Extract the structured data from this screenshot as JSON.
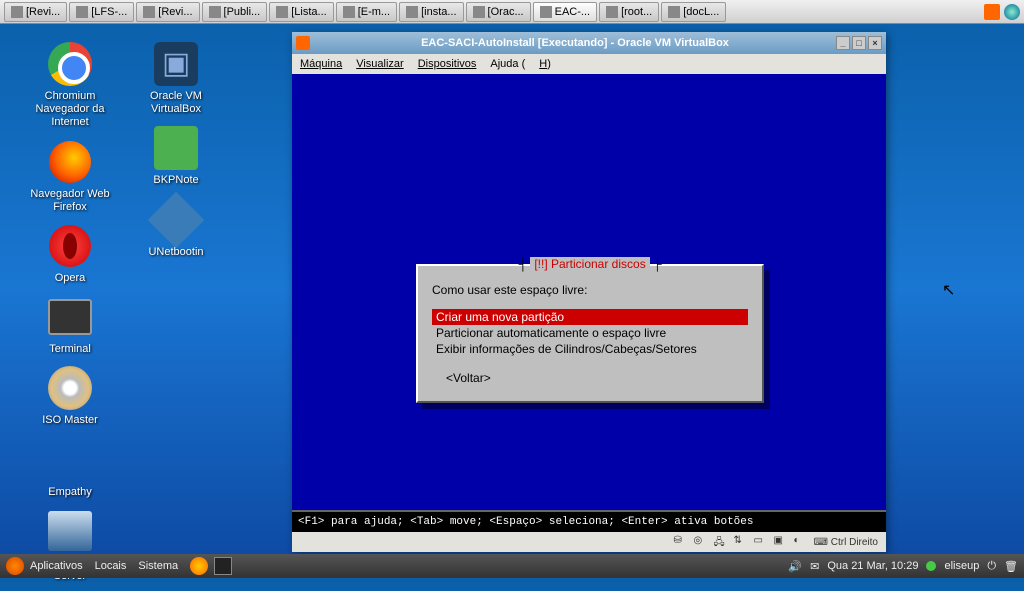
{
  "taskbar": {
    "items": [
      {
        "label": "[Revi..."
      },
      {
        "label": "[LFS-..."
      },
      {
        "label": "[Revi..."
      },
      {
        "label": "[Publi..."
      },
      {
        "label": "[Lista..."
      },
      {
        "label": "[E-m..."
      },
      {
        "label": "[insta..."
      },
      {
        "label": "[Orac..."
      },
      {
        "label": "EAC-..."
      },
      {
        "label": "[root..."
      },
      {
        "label": "[docL..."
      }
    ],
    "active_index": 8
  },
  "desktop": {
    "icons": [
      {
        "name": "chromium",
        "label": "Chromium Navegador da Internet",
        "shape": "ic-chrome"
      },
      {
        "name": "virtualbox",
        "label": "Oracle VM VirtualBox",
        "shape": "ic-vbox"
      },
      {
        "name": "firefox",
        "label": "Navegador Web Firefox",
        "shape": "ic-ff"
      },
      {
        "name": "bkpnote",
        "label": "BKPNote",
        "shape": "ic-bkp"
      },
      {
        "name": "opera",
        "label": "Opera",
        "shape": "ic-opera"
      },
      {
        "name": "unetbootin",
        "label": "UNetbootin",
        "shape": "ic-unet"
      },
      {
        "name": "terminal",
        "label": "Terminal",
        "shape": "ic-term"
      },
      {
        "name": "isomaster",
        "label": "ISO Master",
        "shape": "ic-iso"
      },
      {
        "name": "empathy",
        "label": "Empathy",
        "shape": "ic-emp"
      },
      {
        "name": "cts",
        "label": "Cliente do Terminal Server",
        "shape": "ic-cts"
      }
    ]
  },
  "vbox": {
    "title": "EAC-SACI-AutoInstall [Executando] - Oracle VM VirtualBox",
    "menu": {
      "m1": "Máquina",
      "m2": "Visualizar",
      "m3": "Dispositivos",
      "m4_pre": "Ajuda (",
      "m4_u": "H",
      "m4_post": ")"
    },
    "helpbar": "<F1> para ajuda; <Tab> move; <Espaço> seleciona; <Enter> ativa botões",
    "statusbar": {
      "host": "Ctrl Direito"
    }
  },
  "partitioner": {
    "title": "[!!] Particionar discos",
    "prompt": "Como usar este espaço livre:",
    "options": [
      "Criar uma nova partição",
      "Particionar automaticamente o espaço livre",
      "Exibir informações de Cilindros/Cabeças/Setores"
    ],
    "selected_index": 0,
    "back": "<Voltar>"
  },
  "bottom": {
    "menus": [
      "Aplicativos",
      "Locais",
      "Sistema"
    ],
    "clock": "Qua 21 Mar, 10:29",
    "user": "eliseup"
  }
}
